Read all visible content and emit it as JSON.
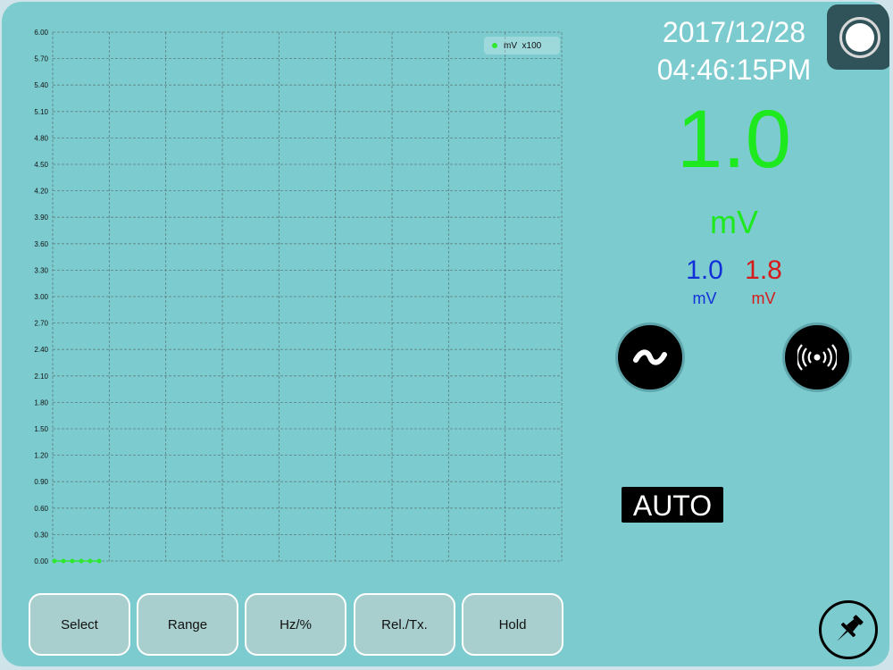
{
  "chart_data": {
    "type": "line",
    "y_ticks": [
      "6.00",
      "5.70",
      "5.40",
      "5.10",
      "4.80",
      "4.50",
      "4.20",
      "3.90",
      "3.60",
      "3.30",
      "3.00",
      "2.70",
      "2.40",
      "2.10",
      "1.80",
      "1.50",
      "1.20",
      "0.90",
      "0.60",
      "0.30",
      "0.00"
    ],
    "ylim": [
      0,
      6
    ],
    "x_divisions": 9,
    "grid": true,
    "legend_position": "top-right",
    "series": [
      {
        "name": "mV  x100",
        "color": "#2ee82e",
        "values": [
          0,
          0,
          0,
          0,
          0,
          0
        ]
      }
    ]
  },
  "legend": {
    "label": "mV  x100"
  },
  "header": {
    "date": "2017/12/28",
    "time": "04:46:15PM"
  },
  "reading": {
    "main_value": "1.0",
    "main_unit": "mV",
    "secondary": [
      {
        "value": "1.0",
        "unit": "mV",
        "color": "#1230d8"
      },
      {
        "value": "1.8",
        "unit": "mV",
        "color": "#d61b1b"
      }
    ]
  },
  "mode": {
    "range_label": "AUTO",
    "ac_icon": "tilde-icon",
    "wireless_icon": "signal-icon"
  },
  "buttons": [
    {
      "label": "Select"
    },
    {
      "label": "Range"
    },
    {
      "label": "Hz/%"
    },
    {
      "label": "Rel./Tx."
    },
    {
      "label": "Hold"
    }
  ],
  "icons": {
    "record": "record-icon",
    "pin": "pushpin-icon"
  }
}
